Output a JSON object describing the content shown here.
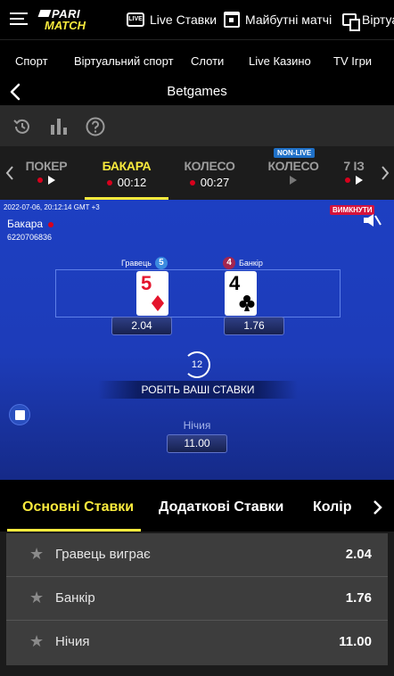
{
  "header": {
    "logo_top": "PARI",
    "logo_bottom": "MATCH",
    "live_badge": "LIVE",
    "nav": [
      "Live Ставки",
      "Майбутні матчі",
      "Віртуа"
    ]
  },
  "subnav": {
    "items": [
      "Спорт",
      "Віртуальний спорт",
      "Слоти",
      "Live Казино",
      "TV Ігри"
    ]
  },
  "page": {
    "title": "Betgames"
  },
  "tools": {
    "icons": [
      "history-icon",
      "stats-icon",
      "help-icon"
    ]
  },
  "game_tabs": {
    "items": [
      {
        "name": "ПОКЕР",
        "time": ""
      },
      {
        "name": "БАКАРА",
        "time": "00:12",
        "active": true
      },
      {
        "name": "КОЛЕСО",
        "time": "00:27"
      },
      {
        "name": "КОЛЕСО",
        "time": "",
        "badge": "NON-LIVE"
      },
      {
        "name": "7 ІЗ",
        "time": ""
      }
    ]
  },
  "game": {
    "timestamp": "2022-07-06, 20:12:14 GMT +3",
    "mute_label": "ВИМКНУТИ",
    "name": "Бакара",
    "id": "6220706836",
    "player": {
      "label": "Гравець",
      "score": "5",
      "card_rank": "5",
      "odd": "2.04",
      "color": "#3c8be0"
    },
    "banker": {
      "label": "Банкір",
      "score": "4",
      "card_rank": "4",
      "odd": "1.76",
      "color": "#a3264f"
    },
    "timer": "12",
    "banner": "РОБІТЬ ВАШІ СТАВКИ",
    "tie": {
      "label": "Нічия",
      "odd": "11.00"
    }
  },
  "bet_tabs": {
    "items": [
      "Основні Ставки",
      "Додаткові Ставки",
      "Колір"
    ]
  },
  "bets": [
    {
      "name": "Гравець виграє",
      "odd": "2.04"
    },
    {
      "name": "Банкір",
      "odd": "1.76"
    },
    {
      "name": "Нічия",
      "odd": "11.00"
    }
  ],
  "colors": {
    "accent": "#f8ea3d",
    "live_red": "#d8001c",
    "game_blue": "#1d3fc2"
  }
}
